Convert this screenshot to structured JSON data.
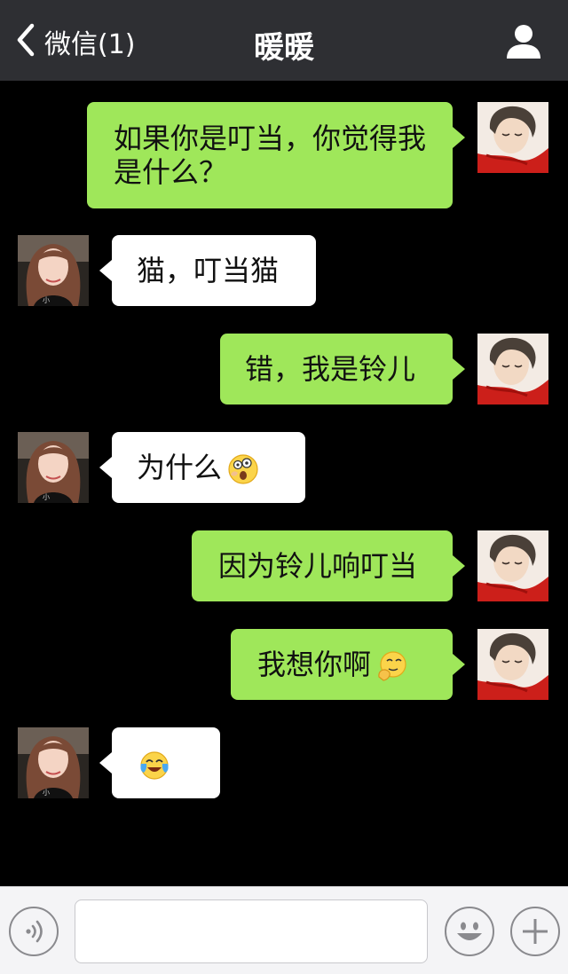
{
  "nav": {
    "back_label": "微信(1)",
    "title": "暖暖"
  },
  "icons": {
    "back": "chevron-left-icon",
    "profile": "person-icon",
    "voice": "voice-icon",
    "emoji": "smiley-icon",
    "more": "plus-icon"
  },
  "colors": {
    "nav_bg": "#2e2f33",
    "chat_bg": "#000000",
    "my_bubble": "#9fe75a",
    "their_bubble": "#ffffff"
  },
  "messages": [
    {
      "sender": "me",
      "text": "如果你是叮当，你觉得我是什么？"
    },
    {
      "sender": "her",
      "text": "猫，叮当猫"
    },
    {
      "sender": "me",
      "text": "错，我是铃儿"
    },
    {
      "sender": "her",
      "text": "为什么",
      "emoji": "surprised-emoji"
    },
    {
      "sender": "me",
      "text": "因为铃儿响叮当"
    },
    {
      "sender": "me",
      "text": "我想你啊",
      "emoji": "thinking-emoji"
    },
    {
      "sender": "her",
      "text": "",
      "emoji": "tears-of-joy-emoji"
    }
  ],
  "input": {
    "value": "",
    "placeholder": ""
  }
}
